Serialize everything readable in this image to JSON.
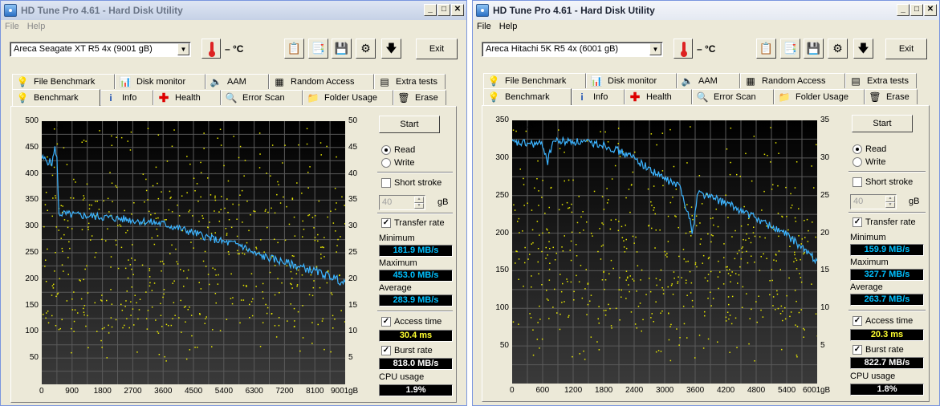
{
  "windows": [
    {
      "title": "HD Tune Pro 4.61 - Hard Disk Utility",
      "menu": [
        "File",
        "Help"
      ],
      "drive": "Areca   Seagate XT R5 4x (9001 gB)",
      "temp": "– °C",
      "exit": "Exit",
      "tabs_top": [
        "File Benchmark",
        "Disk monitor",
        "AAM",
        "Random Access",
        "Extra tests"
      ],
      "tabs_bottom": [
        "Benchmark",
        "Info",
        "Health",
        "Error Scan",
        "Folder Usage",
        "Erase"
      ],
      "active_tab": "Benchmark",
      "start": "Start",
      "read": "Read",
      "write": "Write",
      "mode": "Read",
      "short_stroke": "Short stroke",
      "short_stroke_checked": false,
      "stroke_value": "40",
      "stroke_unit": "gB",
      "transfer_rate": "Transfer rate",
      "transfer_rate_checked": true,
      "min_label": "Minimum",
      "min_value": "181.9 MB/s",
      "max_label": "Maximum",
      "max_value": "453.0 MB/s",
      "avg_label": "Average",
      "avg_value": "283.9 MB/s",
      "access_label": "Access time",
      "access_checked": true,
      "access_value": "30.4 ms",
      "burst_label": "Burst rate",
      "burst_checked": true,
      "burst_value": "818.0 MB/s",
      "cpu_label": "CPU usage",
      "cpu_value": "1.9%",
      "chart_data": {
        "type": "line",
        "ylabel": "MB/s",
        "y2label": "ms",
        "xunit": "gB",
        "ylim": [
          0,
          500
        ],
        "y2lim": [
          0,
          50
        ],
        "xlim": [
          0,
          9001
        ],
        "yticks": [
          "500",
          "450",
          "400",
          "350",
          "300",
          "250",
          "200",
          "150",
          "100",
          "50"
        ],
        "y2ticks": [
          "50",
          "45",
          "40",
          "35",
          "30",
          "25",
          "20",
          "15",
          "10",
          "5"
        ],
        "xticks": [
          "0",
          "900",
          "1800",
          "2700",
          "3600",
          "4500",
          "5400",
          "6300",
          "7200",
          "8100",
          "9001"
        ],
        "transfer_curve": [
          [
            0,
            430
          ],
          [
            150,
            425
          ],
          [
            300,
            420
          ],
          [
            400,
            450
          ],
          [
            450,
            430
          ],
          [
            500,
            325
          ],
          [
            900,
            322
          ],
          [
            1800,
            318
          ],
          [
            2700,
            312
          ],
          [
            3600,
            305
          ],
          [
            4500,
            288
          ],
          [
            5400,
            270
          ],
          [
            5900,
            265
          ],
          [
            6300,
            248
          ],
          [
            7200,
            232
          ],
          [
            8100,
            215
          ],
          [
            8700,
            202
          ],
          [
            9001,
            190
          ]
        ],
        "access_time_ms": 30.4,
        "series": [
          {
            "name": "Transfer rate"
          },
          {
            "name": "Access time"
          }
        ]
      }
    },
    {
      "title": "HD Tune Pro 4.61 - Hard Disk Utility",
      "menu": [
        "File",
        "Help"
      ],
      "drive": "Areca   Hitachi 5K R5 4x (6001 gB)",
      "temp": "– °C",
      "exit": "Exit",
      "tabs_top": [
        "File Benchmark",
        "Disk monitor",
        "AAM",
        "Random Access",
        "Extra tests"
      ],
      "tabs_bottom": [
        "Benchmark",
        "Info",
        "Health",
        "Error Scan",
        "Folder Usage",
        "Erase"
      ],
      "active_tab": "Benchmark",
      "start": "Start",
      "read": "Read",
      "write": "Write",
      "mode": "Read",
      "short_stroke": "Short stroke",
      "short_stroke_checked": false,
      "stroke_value": "40",
      "stroke_unit": "gB",
      "transfer_rate": "Transfer rate",
      "transfer_rate_checked": true,
      "min_label": "Minimum",
      "min_value": "159.9 MB/s",
      "max_label": "Maximum",
      "max_value": "327.7 MB/s",
      "avg_label": "Average",
      "avg_value": "263.7 MB/s",
      "access_label": "Access time",
      "access_checked": true,
      "access_value": "20.3 ms",
      "burst_label": "Burst rate",
      "burst_checked": true,
      "burst_value": "822.7 MB/s",
      "cpu_label": "CPU usage",
      "cpu_value": "1.8%",
      "chart_data": {
        "type": "line",
        "ylabel": "MB/s",
        "y2label": "ms",
        "xunit": "gB",
        "ylim": [
          0,
          350
        ],
        "y2lim": [
          0,
          35
        ],
        "xlim": [
          0,
          6001
        ],
        "yticks": [
          "350",
          "300",
          "250",
          "200",
          "150",
          "100",
          "50"
        ],
        "y2ticks": [
          "35",
          "30",
          "25",
          "20",
          "15",
          "10",
          "5"
        ],
        "xticks": [
          "0",
          "600",
          "1200",
          "1800",
          "2400",
          "3000",
          "3600",
          "4200",
          "4800",
          "5400",
          "6001"
        ],
        "transfer_curve": [
          [
            0,
            320
          ],
          [
            600,
            318
          ],
          [
            700,
            295
          ],
          [
            800,
            322
          ],
          [
            1200,
            322
          ],
          [
            1800,
            318
          ],
          [
            2400,
            300
          ],
          [
            2700,
            285
          ],
          [
            3000,
            272
          ],
          [
            3300,
            262
          ],
          [
            3450,
            230
          ],
          [
            3550,
            200
          ],
          [
            3650,
            255
          ],
          [
            4200,
            240
          ],
          [
            4800,
            220
          ],
          [
            5400,
            198
          ],
          [
            6001,
            163
          ]
        ],
        "access_time_ms": 20.3,
        "series": [
          {
            "name": "Transfer rate"
          },
          {
            "name": "Access time"
          }
        ]
      }
    }
  ],
  "colors": {
    "transfer": "#3cb4ff",
    "access": "#e8e800",
    "grid": "#5a5a5a",
    "chart_bg_top": "#000000",
    "chart_bg_bottom": "#3a3a3a"
  }
}
